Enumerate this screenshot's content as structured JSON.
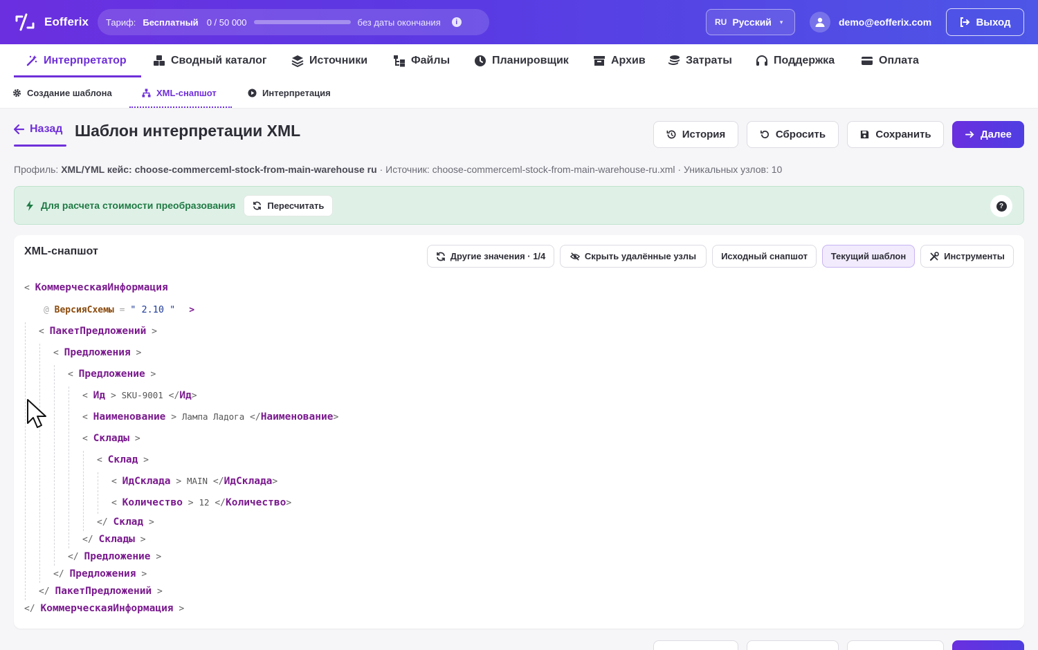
{
  "brand": {
    "name": "Eofferix"
  },
  "plan": {
    "label": "Тариф:",
    "name": "Бесплатный",
    "usage": "0 / 50 000",
    "usage_fraction": 0.0,
    "end": "без даты окончания"
  },
  "lang": {
    "code": "RU",
    "name": "Русский"
  },
  "user": {
    "email": "demo@eofferix.com"
  },
  "logout_label": "Выход",
  "main_nav": [
    {
      "label": "Интерпретатор",
      "icon": "magic-wand-icon",
      "active": true
    },
    {
      "label": "Сводный каталог",
      "icon": "boxes-icon"
    },
    {
      "label": "Источники",
      "icon": "layers-icon"
    },
    {
      "label": "Файлы",
      "icon": "folder-tree-icon"
    },
    {
      "label": "Планировщик",
      "icon": "clock-icon"
    },
    {
      "label": "Архив",
      "icon": "archive-icon"
    },
    {
      "label": "Затраты",
      "icon": "coins-icon"
    },
    {
      "label": "Поддержка",
      "icon": "headset-icon"
    },
    {
      "label": "Оплата",
      "icon": "credit-card-icon"
    }
  ],
  "sub_nav": [
    {
      "label": "Создание шаблона",
      "icon": "gear-icon"
    },
    {
      "label": "XML-снапшот",
      "icon": "sitemap-icon",
      "active": true
    },
    {
      "label": "Интерпретация",
      "icon": "play-circle-icon"
    }
  ],
  "header": {
    "back": "Назад",
    "title": "Шаблон интерпретации XML",
    "buttons": {
      "history": "История",
      "reset": "Сбросить",
      "save": "Сохранить",
      "next": "Далее"
    }
  },
  "meta": {
    "profile_label": "Профиль:",
    "profile_value": "XML/YML кейс: choose-commerceml-stock-from-main-warehouse ru",
    "rest": " · Источник: choose-commerceml-stock-from-main-warehouse-ru.xml · Уникальных узлов: 10"
  },
  "notice": {
    "text": "Для расчета стоимости преобразования",
    "recalc": "Пересчитать",
    "help": "?"
  },
  "snapshot": {
    "title": "XML-снапшот",
    "buttons": {
      "other_values": "Другие значения · 1/4",
      "hide_deleted": "Скрыть удалённые узлы",
      "source": "Исходный снапшот",
      "current": "Текущий шаблон",
      "tools": "Инструменты"
    },
    "xml": {
      "root": "КоммерческаяИнформация",
      "attr_name": "ВерсияСхемы",
      "attr_value": "2.10",
      "package": "ПакетПредложений",
      "offers": "Предложения",
      "offer": "Предложение",
      "id_tag": "Ид",
      "id_value": "SKU-9001",
      "name_tag": "Наименование",
      "name_value": "Лампа Ладога",
      "stores": "Склады",
      "store": "Склад",
      "store_id_tag": "ИдСклада",
      "store_id_value": "MAIN",
      "qty_tag": "Количество",
      "qty_value": "12"
    }
  },
  "colors": {
    "accent": "#6f2fd9",
    "notice_bg": "#dff1e7",
    "notice_text": "#1f7a44"
  }
}
